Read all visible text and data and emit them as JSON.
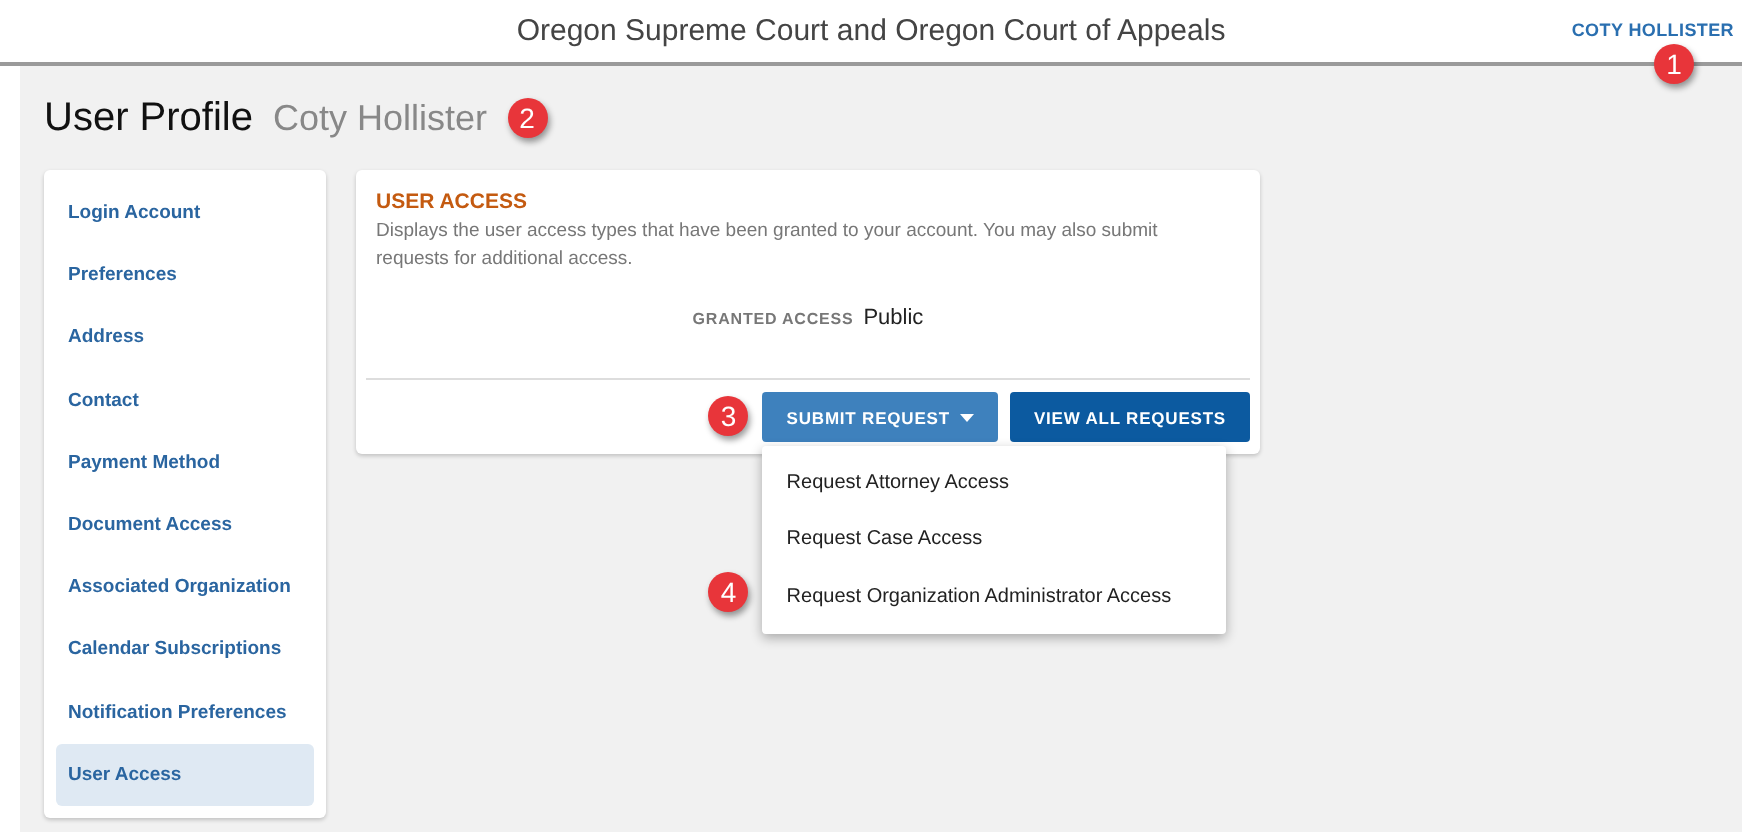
{
  "header": {
    "title": "Oregon Supreme Court and Oregon Court of Appeals",
    "user": "COTY HOLLISTER"
  },
  "page": {
    "title": "User Profile",
    "subtitle": "Coty Hollister"
  },
  "sidebar": {
    "items": [
      {
        "label": "Login Account",
        "selected": false
      },
      {
        "label": "Preferences",
        "selected": false
      },
      {
        "label": "Address",
        "selected": false
      },
      {
        "label": "Contact",
        "selected": false
      },
      {
        "label": "Payment Method",
        "selected": false
      },
      {
        "label": "Document Access",
        "selected": false
      },
      {
        "label": "Associated Organization",
        "selected": false
      },
      {
        "label": "Calendar Subscriptions",
        "selected": false
      },
      {
        "label": "Notification Preferences",
        "selected": false
      },
      {
        "label": "User Access",
        "selected": true
      }
    ]
  },
  "card": {
    "title": "USER ACCESS",
    "description": "Displays the user access types that have been granted to your account. You may also submit requests for additional access.",
    "granted_label": "GRANTED ACCESS",
    "granted_value": "Public",
    "buttons": [
      {
        "label": "SUBMIT REQUEST",
        "kind": "dropdown",
        "expanded": true
      },
      {
        "label": "VIEW ALL REQUESTS",
        "kind": "plain"
      }
    ]
  },
  "dropdown_menu": {
    "items": [
      "Request Attorney Access",
      "Request Case Access",
      "Request Organization Administrator Access"
    ]
  },
  "callouts": [
    "1",
    "2",
    "3",
    "4"
  ]
}
